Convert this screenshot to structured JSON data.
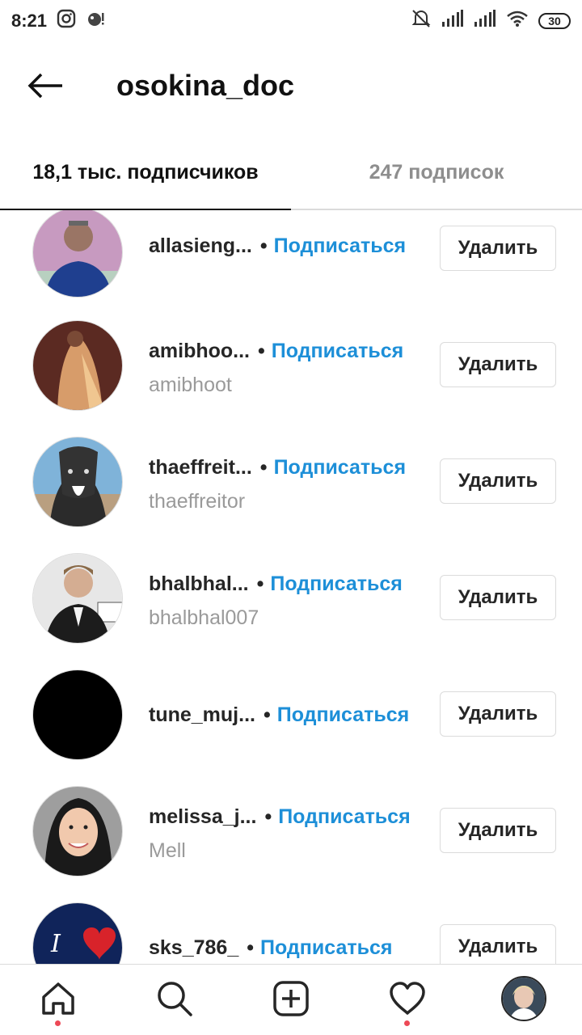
{
  "status_bar": {
    "time": "8:21",
    "battery": "30"
  },
  "header": {
    "title": "osokina_doc"
  },
  "tabs": {
    "followers": "18,1 тыс. подписчиков",
    "following": "247 подписок"
  },
  "followers": [
    {
      "username": "allasieng...",
      "full_name": "",
      "follow_label": "Подписаться",
      "remove_label": "Удалить"
    },
    {
      "username": "amibhoo...",
      "full_name": "amibhoot",
      "follow_label": "Подписаться",
      "remove_label": "Удалить"
    },
    {
      "username": "thaeffreit...",
      "full_name": "thaeffreitor",
      "follow_label": "Подписаться",
      "remove_label": "Удалить"
    },
    {
      "username": "bhalbhal...",
      "full_name": "bhalbhal007",
      "follow_label": "Подписаться",
      "remove_label": "Удалить"
    },
    {
      "username": "tune_muj...",
      "full_name": "",
      "follow_label": "Подписаться",
      "remove_label": "Удалить"
    },
    {
      "username": "melissa_j...",
      "full_name": "Mell",
      "follow_label": "Подписаться",
      "remove_label": "Удалить"
    },
    {
      "username": "sks_786_",
      "full_name": "",
      "follow_label": "Подписаться",
      "remove_label": "Удалить"
    }
  ],
  "colors": {
    "link": "#1d8fd8",
    "notification_dot": "#ed4956"
  },
  "bottom_nav": [
    "home-icon",
    "search-icon",
    "new-post-icon",
    "activity-heart-icon",
    "profile-avatar"
  ]
}
